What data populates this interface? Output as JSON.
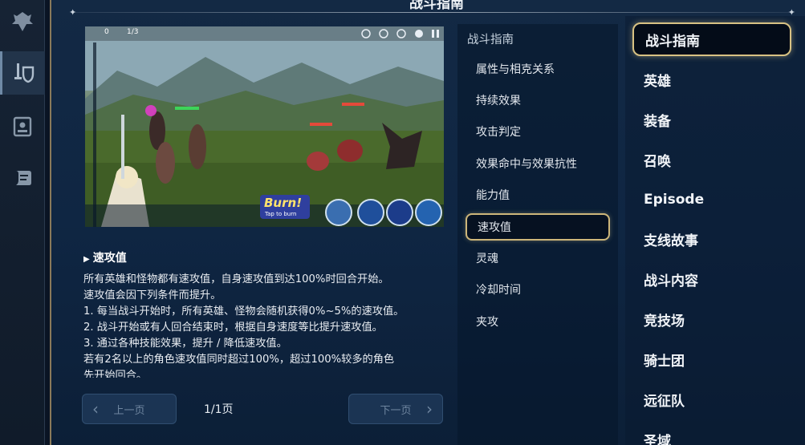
{
  "header": {
    "title": "战斗指南"
  },
  "rail": {
    "icons": [
      "emblem-icon",
      "sword-shield-icon",
      "card-icon",
      "scroll-icon"
    ]
  },
  "screenshot": {
    "hud_energy": "0",
    "hud_turn": "1/3",
    "burn_text": "Burn!",
    "burn_sub": "Tap to burn"
  },
  "description": {
    "title": "速攻值",
    "lines": [
      "所有英雄和怪物都有速攻值，自身速攻值到达100%时回合开始。",
      "速攻值会因下列条件而提升。",
      "1. 每当战斗开始时，所有英雄、怪物会随机获得0%~5%的速攻值。",
      "2. 战斗开始或有人回合结束时，根据自身速度等比提升速攻值。",
      "3. 通过各种技能效果，提升 / 降低速攻值。",
      "若有2名以上的角色速攻值同时超过100%，超过100%较多的角色",
      "先开始回合。"
    ]
  },
  "pager": {
    "prev": "上一页",
    "next": "下一页",
    "info": "1/1页"
  },
  "submenu": {
    "heading": "战斗指南",
    "items": [
      "属性与相克关系",
      "持续效果",
      "攻击判定",
      "效果命中与效果抗性",
      "能力值",
      "速攻值",
      "灵魂",
      "冷却时间",
      "夹攻"
    ],
    "selected_index": 5
  },
  "categories": {
    "items": [
      "战斗指南",
      "英雄",
      "装备",
      "召唤",
      "Episode",
      "支线故事",
      "战斗内容",
      "竞技场",
      "骑士团",
      "远征队",
      "圣域"
    ],
    "selected_index": 0
  },
  "colors": {
    "accent_gold": "#d8c283",
    "panel_blue": "#0f2643"
  }
}
